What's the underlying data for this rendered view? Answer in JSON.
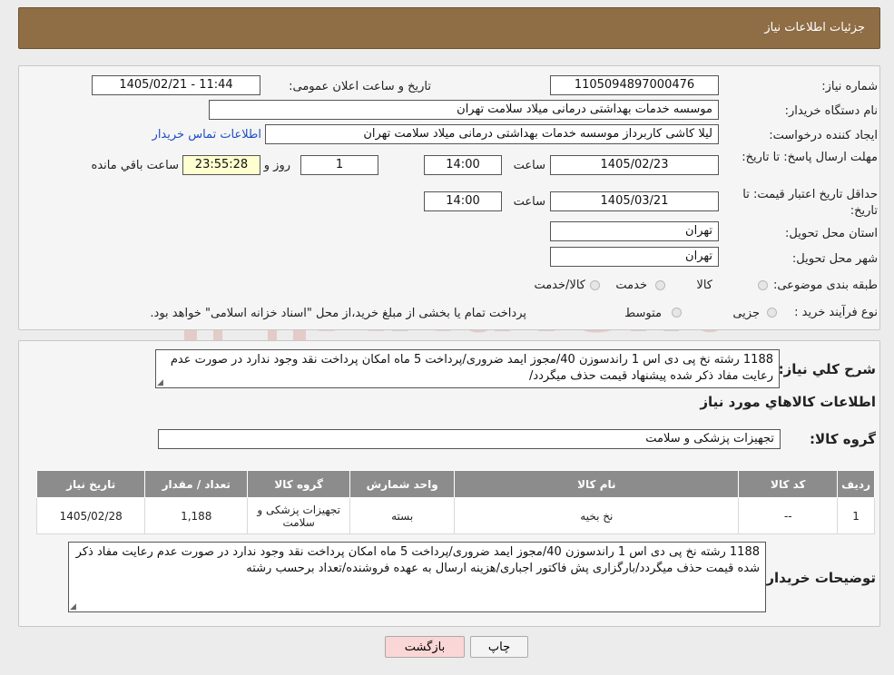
{
  "header": {
    "title": "جزئیات اطلاعات نیاز"
  },
  "form": {
    "need_number_label": "شماره نیاز:",
    "need_number": "1105094897000476",
    "announce_label": "تاریخ و ساعت اعلان عمومی:",
    "announce_value": "1405/02/21 - 11:44",
    "buyer_org_label": "نام دستگاه خریدار:",
    "buyer_org": "موسسه خدمات بهداشتی درمانی میلاد سلامت تهران",
    "requester_label": "ایجاد کننده درخواست:",
    "requester": "لیلا کاشی کاربرداز موسسه خدمات بهداشتی درمانی میلاد سلامت تهران",
    "contact_link": "اطلاعات تماس خریدار",
    "reply_deadline_label": "مهلت ارسال پاسخ: تا تاریخ:",
    "reply_date": "1405/02/23",
    "time_label": "ساعت",
    "reply_time": "14:00",
    "days_value": "1",
    "days_label": "روز و",
    "remaining_time": "23:55:28",
    "remaining_label": "ساعت باقي مانده",
    "price_validity_label": "حداقل تاریخ اعتبار قیمت: تا تاریخ:",
    "price_date": "1405/03/21",
    "price_time": "14:00",
    "province_label": "استان محل تحویل:",
    "province": "تهران",
    "city_label": "شهر محل تحویل:",
    "city": "تهران",
    "category_label": "طبقه بندی موضوعی:",
    "category_options": [
      "کالا",
      "خدمت",
      "کالا/خدمت"
    ],
    "process_label": "نوع فرآیند خرید :",
    "process_options": [
      "جزیی",
      "متوسط"
    ],
    "process_note": "پرداخت تمام یا بخشی از مبلغ خرید،از محل \"اسناد خزانه اسلامی\" خواهد بود."
  },
  "details": {
    "summary_label": "شرح کلي نياز:",
    "summary_text": "1188 رشته نخ پی دی اس 1 راندسوزن 40/مجوز ایمد ضروری/پرداخت 5 ماه امکان پرداخت نقد وجود ندارد در صورت عدم رعایت مفاد ذکر شده پیشنهاد قیمت حذف میگردد/",
    "goods_info_title": "اطلاعات کالاهاي مورد نياز",
    "goods_group_label": "گروه کالا:",
    "goods_group": "تجهیزات پزشکی و سلامت",
    "table": {
      "headers": [
        "ردیف",
        "کد کالا",
        "نام کالا",
        "واحد شمارش",
        "گروه کالا",
        "تعداد / مقدار",
        "تاریخ نیاز"
      ],
      "rows": [
        [
          "1",
          "--",
          "نخ بخیه",
          "بسته",
          "تجهیزات پزشکی و سلامت",
          "1,188",
          "1405/02/28"
        ]
      ]
    },
    "buyer_notes_label": "توضیحات خریدار:",
    "buyer_notes": "1188 رشته نخ پی دی اس 1 راندسوزن 40/مجوز ایمد ضروری/پرداخت 5 ماه امکان پرداخت نقد وجود ندارد در صورت عدم رعایت مفاد ذکر شده قیمت حذف میگردد/بارگزاری پش فاکتور اجباری/هزینه ارسال به عهده فروشنده/تعداد برحسب رشته"
  },
  "buttons": {
    "print": "چاپ",
    "back": "بازگشت"
  },
  "colors": {
    "header": "#8f6d45",
    "table_header": "#8c8c8c",
    "back_button": "#fbd6d6",
    "print_button": "#f4f4f4"
  },
  "watermark": "AriaTender.neT"
}
